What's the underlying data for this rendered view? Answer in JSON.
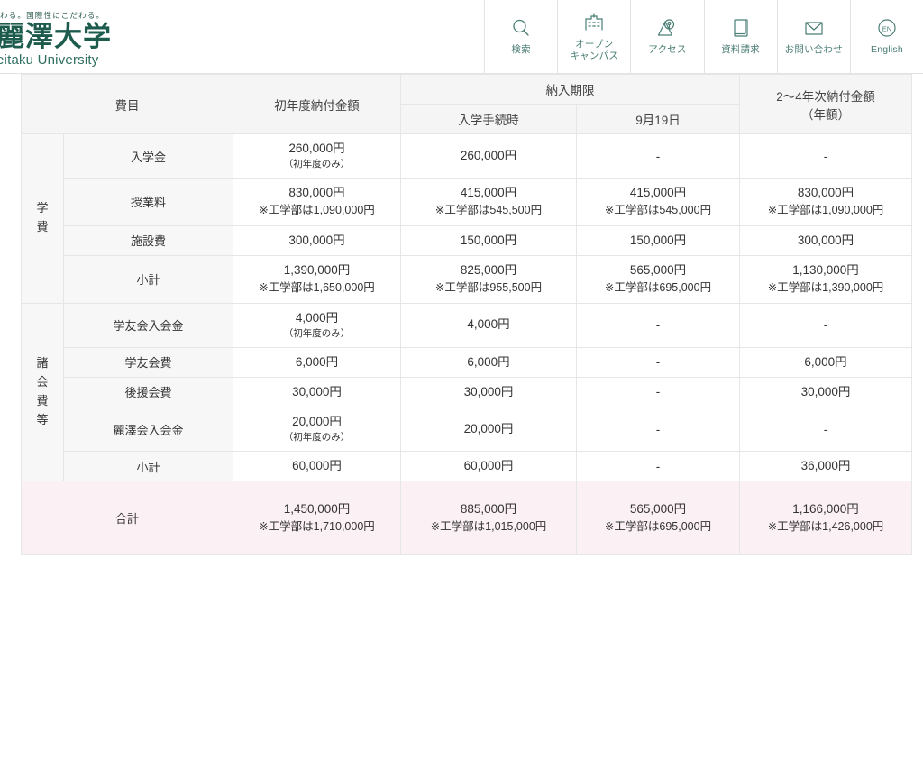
{
  "header": {
    "brand": {
      "tagline": "わる。国際性にこだわる。",
      "name_ja": "麗澤大学",
      "name_en": "eitaku University"
    },
    "nav": [
      {
        "icon": "search-icon",
        "label": "検索"
      },
      {
        "icon": "building-icon",
        "label": "オープン\nキャンパス"
      },
      {
        "icon": "map-pin-icon",
        "label": "アクセス"
      },
      {
        "icon": "book-icon",
        "label": "資料請求"
      },
      {
        "icon": "envelope-icon",
        "label": "お問い合わせ"
      },
      {
        "icon": "language-en-icon",
        "label": "English"
      }
    ]
  },
  "colors": {
    "brand_green": "#1d5c4d",
    "nav_teal": "#4a7d74",
    "header_bg": "#f5f5f5",
    "label_bg": "#f7f7f7",
    "total_bg": "#fbf0f3",
    "border": "#e6e6e6"
  },
  "table": {
    "headers": {
      "item": "費目",
      "first_year": "初年度納付金額",
      "due_group": "納入期限",
      "due_1": "入学手続時",
      "due_2": "9月19日",
      "later_years": "2〜4年次納付金額\n（年額）",
      "later_years_line1": "2〜4年次納付金額",
      "later_years_line2": "（年額）"
    },
    "groups": [
      {
        "label": "学費",
        "label_chars": [
          "学",
          "費"
        ],
        "rows": [
          {
            "item": "入学金",
            "first_year": {
              "main": "260,000円",
              "sub": "（初年度のみ）"
            },
            "due_1": {
              "main": "260,000円"
            },
            "due_2": {
              "main": "-"
            },
            "later": {
              "main": "-"
            }
          },
          {
            "item": "授業料",
            "first_year": {
              "main": "830,000円",
              "note": "※工学部は1,090,000円"
            },
            "due_1": {
              "main": "415,000円",
              "note": "※工学部は545,500円"
            },
            "due_2": {
              "main": "415,000円",
              "note": "※工学部は545,000円"
            },
            "later": {
              "main": "830,000円",
              "note": "※工学部は1,090,000円"
            }
          },
          {
            "item": "施設費",
            "first_year": {
              "main": "300,000円"
            },
            "due_1": {
              "main": "150,000円"
            },
            "due_2": {
              "main": "150,000円"
            },
            "later": {
              "main": "300,000円"
            }
          },
          {
            "item": "小計",
            "first_year": {
              "main": "1,390,000円",
              "note": "※工学部は1,650,000円"
            },
            "due_1": {
              "main": "825,000円",
              "note": "※工学部は955,500円"
            },
            "due_2": {
              "main": "565,000円",
              "note": "※工学部は695,000円"
            },
            "later": {
              "main": "1,130,000円",
              "note": "※工学部は1,390,000円"
            }
          }
        ]
      },
      {
        "label": "諸会費等",
        "label_chars": [
          "諸",
          "会",
          "費",
          "等"
        ],
        "rows": [
          {
            "item": "学友会入会金",
            "first_year": {
              "main": "4,000円",
              "sub": "（初年度のみ）"
            },
            "due_1": {
              "main": "4,000円"
            },
            "due_2": {
              "main": "-"
            },
            "later": {
              "main": "-"
            }
          },
          {
            "item": "学友会費",
            "first_year": {
              "main": "6,000円"
            },
            "due_1": {
              "main": "6,000円"
            },
            "due_2": {
              "main": "-"
            },
            "later": {
              "main": "6,000円"
            }
          },
          {
            "item": "後援会費",
            "first_year": {
              "main": "30,000円"
            },
            "due_1": {
              "main": "30,000円"
            },
            "due_2": {
              "main": "-"
            },
            "later": {
              "main": "30,000円"
            }
          },
          {
            "item": "麗澤会入会金",
            "first_year": {
              "main": "20,000円",
              "sub": "（初年度のみ）"
            },
            "due_1": {
              "main": "20,000円"
            },
            "due_2": {
              "main": "-"
            },
            "later": {
              "main": "-"
            }
          },
          {
            "item": "小計",
            "first_year": {
              "main": "60,000円"
            },
            "due_1": {
              "main": "60,000円"
            },
            "due_2": {
              "main": "-"
            },
            "later": {
              "main": "36,000円"
            }
          }
        ]
      }
    ],
    "total": {
      "item": "合計",
      "first_year": {
        "main": "1,450,000円",
        "note": "※工学部は1,710,000円"
      },
      "due_1": {
        "main": "885,000円",
        "note": "※工学部は1,015,000円"
      },
      "due_2": {
        "main": "565,000円",
        "note": "※工学部は695,000円"
      },
      "later": {
        "main": "1,166,000円",
        "note": "※工学部は1,426,000円"
      }
    }
  }
}
